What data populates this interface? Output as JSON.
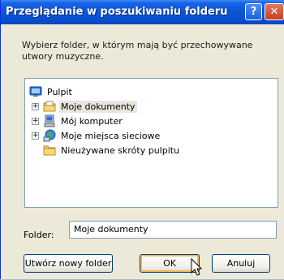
{
  "window": {
    "title": "Przeglądanie w poszukiwaniu folderu",
    "help_label": "?",
    "close_label": "✕"
  },
  "description": "Wybierz folder, w którym mają być przechowywane utwory muzyczne.",
  "tree": {
    "items": [
      {
        "label": "Pulpit",
        "icon": "desktop-icon",
        "expandable": false
      },
      {
        "label": "Moje dokumenty",
        "icon": "my-documents-icon",
        "expandable": true,
        "expander": "+"
      },
      {
        "label": "Mój komputer",
        "icon": "my-computer-icon",
        "expandable": true,
        "expander": "+"
      },
      {
        "label": "Moje miejsca sieciowe",
        "icon": "network-places-icon",
        "expandable": true,
        "expander": "+"
      },
      {
        "label": "Nieużywane skróty pulpitu",
        "icon": "folder-icon",
        "expandable": false
      }
    ]
  },
  "folder": {
    "label": "Folder:",
    "value": "Moje dokumenty"
  },
  "buttons": {
    "new_folder": "Utwórz nowy folder",
    "ok": "OK",
    "cancel": "Anuluj"
  },
  "colors": {
    "titlebar": "#0a55d8",
    "dialog_bg": "#ece9d8",
    "input_border": "#7f9db9",
    "button_border": "#003c74",
    "ok_focus": "#f7b65a"
  }
}
